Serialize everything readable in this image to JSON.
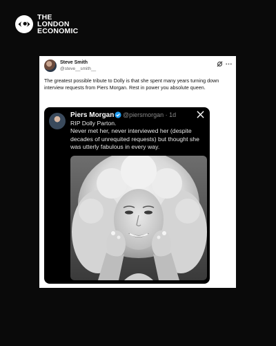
{
  "brand": {
    "line1": "THE",
    "line2": "LONDON",
    "line3": "ECONOMIC",
    "logo_icon": "eye-icon"
  },
  "tweet": {
    "author_name": "Steve Smith",
    "author_handle": "@steve__smith__",
    "text": "The greatest possible tribute to Dolly is that she spent many years turning down interview requests from Piers Morgan. Rest in power you absolute queen.",
    "icons": [
      "grok-icon",
      "more-icon"
    ]
  },
  "quote": {
    "author_name": "Piers Morgan",
    "handle_time": "@piersmorgan · 1d",
    "text": "RIP Dolly Parton.\nNever met her, never interviewed her (despite decades of unrequited requests) but thought she was utterly fabulous in every way.",
    "verified_color": "#1d9bf0",
    "icons": [
      "verified-icon",
      "x-logo-icon"
    ],
    "photo": "black-and-white portrait photo"
  }
}
